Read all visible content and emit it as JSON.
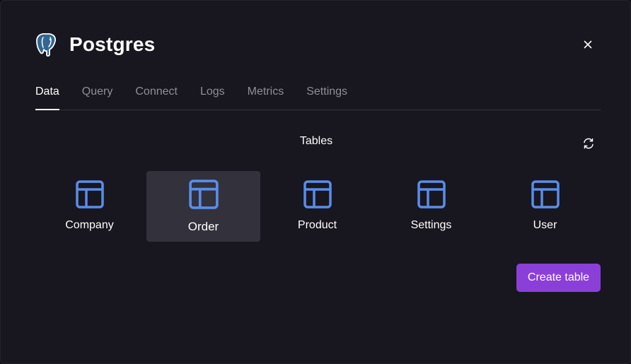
{
  "header": {
    "title": "Postgres",
    "logo_icon": "postgres-elephant-icon",
    "close_icon": "close-icon"
  },
  "tabs": [
    {
      "label": "Data",
      "active": true
    },
    {
      "label": "Query",
      "active": false
    },
    {
      "label": "Connect",
      "active": false
    },
    {
      "label": "Logs",
      "active": false
    },
    {
      "label": "Metrics",
      "active": false
    },
    {
      "label": "Settings",
      "active": false
    }
  ],
  "tables_section": {
    "title": "Tables",
    "refresh_icon": "refresh-icon",
    "items": [
      {
        "label": "Company",
        "selected": false,
        "icon": "table-icon"
      },
      {
        "label": "Order",
        "selected": true,
        "icon": "table-icon"
      },
      {
        "label": "Product",
        "selected": false,
        "icon": "table-icon"
      },
      {
        "label": "Settings",
        "selected": false,
        "icon": "table-icon"
      },
      {
        "label": "User",
        "selected": false,
        "icon": "table-icon"
      }
    ]
  },
  "actions": {
    "create_table_label": "Create table"
  },
  "colors": {
    "background": "#18171f",
    "accent": "#8b3fd9",
    "icon_blue": "#5a8de8",
    "selected_card": "#32313c"
  }
}
